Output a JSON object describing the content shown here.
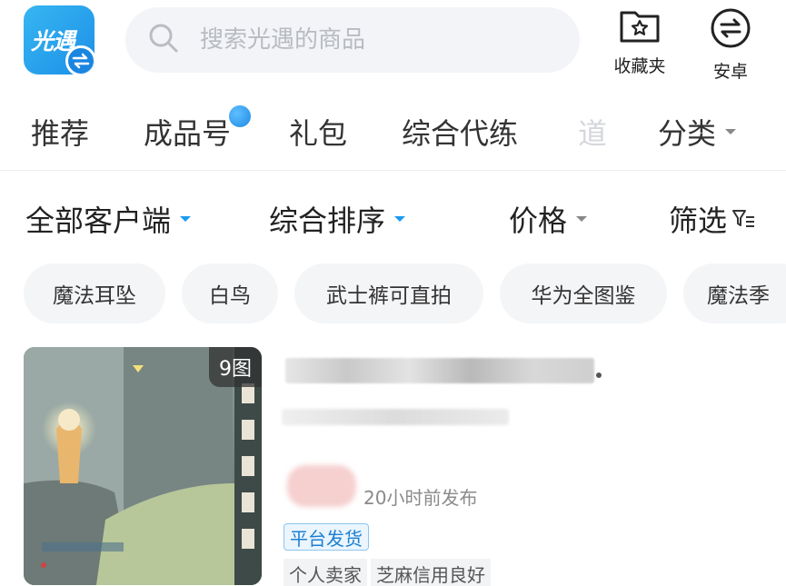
{
  "app": {
    "logo_text": "光遇"
  },
  "search": {
    "placeholder": "搜索光遇的商品"
  },
  "header_actions": {
    "favorites_label": "收藏夹",
    "android_label": "安卓"
  },
  "tabs": [
    {
      "label": "推荐"
    },
    {
      "label": "成品号"
    },
    {
      "label": "礼包"
    },
    {
      "label": "综合代练"
    },
    {
      "label": "道"
    },
    {
      "label": "分类"
    }
  ],
  "filters": {
    "client": "全部客户端",
    "sort": "综合排序",
    "price": "价格",
    "filter": "筛选"
  },
  "chips": [
    "魔法耳坠",
    "白鸟",
    "武士裤可直拍",
    "华为全图鉴",
    "魔法季"
  ],
  "listing": {
    "image_count": "9图",
    "post_time": "20小时前发布",
    "platform_tag": "平台发货",
    "seller_tags": [
      "个人卖家",
      "芝麻信用良好"
    ]
  },
  "colors": {
    "accent": "#1a9af0",
    "logo": "#1d8fe6",
    "tag_blue": "#1d7fd1"
  }
}
